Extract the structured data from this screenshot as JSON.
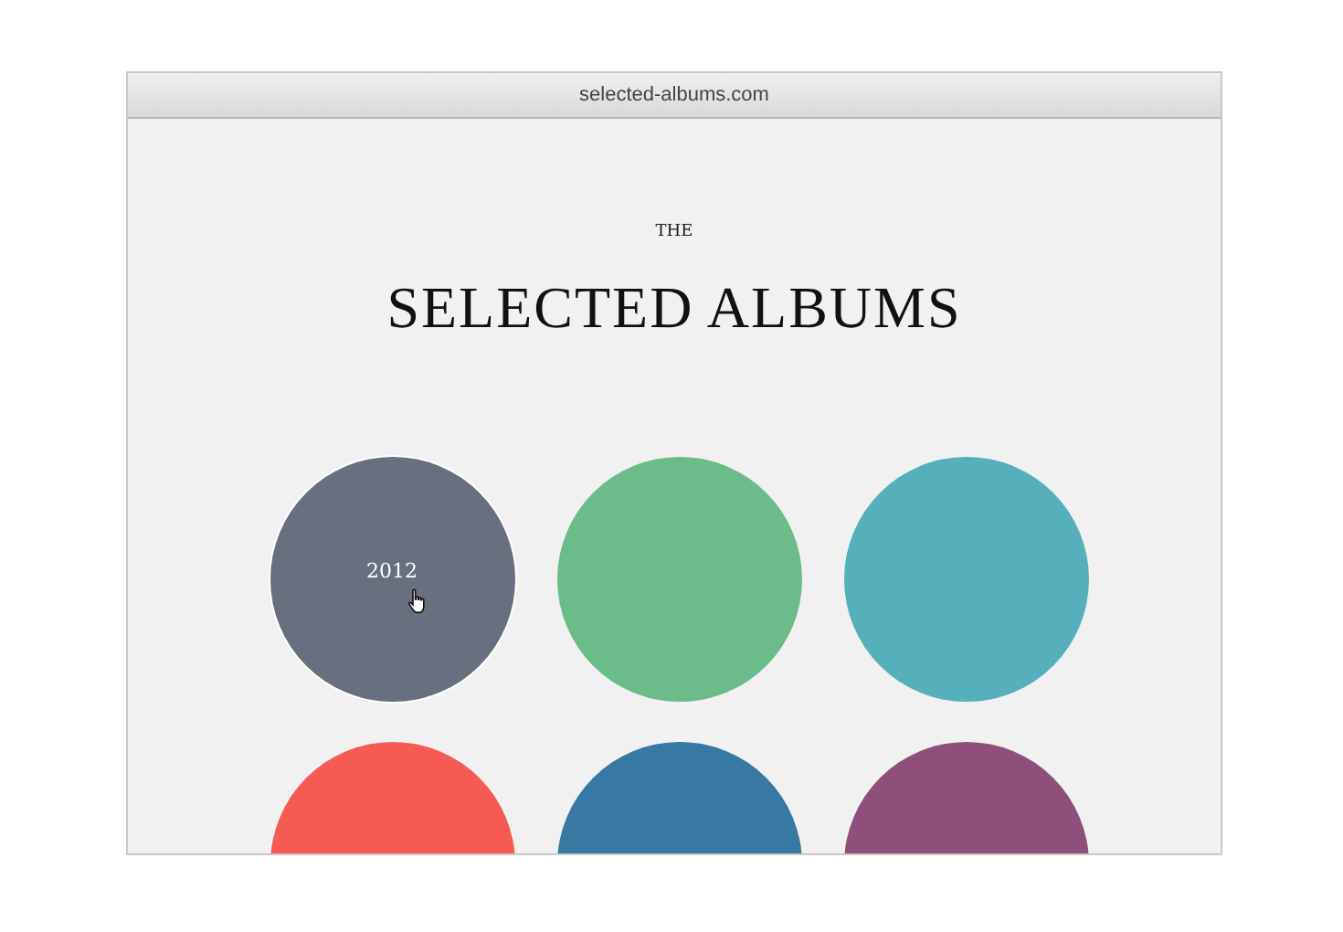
{
  "window": {
    "title": "selected-albums.com"
  },
  "header": {
    "kicker": "THE",
    "title": "SELECTED ALBUMS"
  },
  "albums": [
    {
      "color": "#68707f",
      "label": "2012",
      "hovered": true
    },
    {
      "color": "#6bbc8a",
      "hovered": false
    },
    {
      "color": "#55b0bb",
      "hovered": false
    },
    {
      "color": "#f55b52",
      "hovered": false
    },
    {
      "color": "#3779a2",
      "hovered": false
    },
    {
      "color": "#8e507a",
      "hovered": false
    }
  ]
}
